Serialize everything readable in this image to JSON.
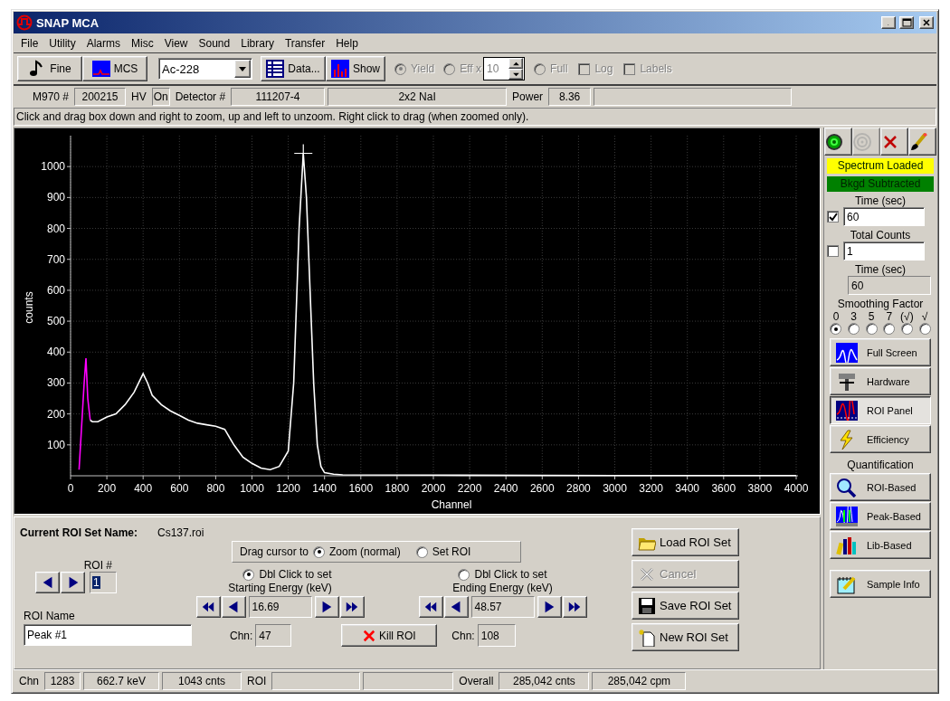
{
  "window": {
    "title": "SNAP MCA"
  },
  "menu": [
    "File",
    "Utility",
    "Alarms",
    "Misc",
    "View",
    "Sound",
    "Library",
    "Transfer",
    "Help"
  ],
  "toolbar": [
    {
      "kind": "button",
      "label": "Fine"
    },
    {
      "kind": "button",
      "label": "MCS"
    },
    {
      "kind": "combo",
      "value": "Ac-228"
    },
    {
      "kind": "button",
      "label": "Data..."
    },
    {
      "kind": "button",
      "label": "Show"
    },
    {
      "kind": "radio",
      "label": "Yield",
      "selected": true,
      "disabled": true
    },
    {
      "kind": "radio",
      "label": "Eff x",
      "selected": false,
      "disabled": true
    },
    {
      "kind": "spin",
      "value": "10",
      "disabled": true
    },
    {
      "kind": "radio",
      "label": "Full",
      "selected": false,
      "disabled": true
    },
    {
      "kind": "checkbox",
      "label": "Log",
      "checked": false,
      "disabled": true
    },
    {
      "kind": "checkbox",
      "label": "Labels",
      "checked": false,
      "disabled": true
    }
  ],
  "info": [
    {
      "kind": "label",
      "text": "M970 #"
    },
    {
      "kind": "field",
      "text": "200215"
    },
    {
      "kind": "label",
      "text": "HV"
    },
    {
      "kind": "field",
      "text": "On"
    },
    {
      "kind": "label",
      "text": "Detector #"
    },
    {
      "kind": "field",
      "text": "111207-4"
    },
    {
      "kind": "field",
      "text": "2x2 NaI"
    },
    {
      "kind": "label",
      "text": "Power"
    },
    {
      "kind": "field",
      "text": "8.36"
    },
    {
      "kind": "field"
    }
  ],
  "hint": "Click and drag box down and right to zoom, up and left to unzoom. Right click to drag (when zoomed only).",
  "chart": {
    "chart_data": {
      "type": "line",
      "xlabel": "Channel",
      "ylabel": "counts",
      "xlim": [
        0,
        4000
      ],
      "ylim": [
        0,
        1100
      ],
      "grid": true,
      "xticks": [
        0,
        200,
        400,
        600,
        800,
        1000,
        1200,
        1400,
        1600,
        1800,
        2000,
        2200,
        2400,
        2600,
        2800,
        3000,
        3200,
        3400,
        3600,
        3800,
        4000
      ],
      "yticks": [
        100,
        200,
        300,
        400,
        500,
        600,
        700,
        800,
        900,
        1000
      ],
      "x": [
        47,
        60,
        75,
        85,
        95,
        108,
        120,
        150,
        200,
        250,
        300,
        350,
        400,
        425,
        450,
        500,
        550,
        600,
        650,
        700,
        750,
        800,
        850,
        900,
        950,
        1000,
        1050,
        1100,
        1150,
        1200,
        1230,
        1260,
        1283,
        1300,
        1320,
        1340,
        1360,
        1380,
        1400,
        1450,
        1500,
        2000,
        3000,
        4000
      ],
      "series": [
        {
          "color": "#ff00ff",
          "values": [
            20,
            150,
            300,
            380,
            250,
            180,
            null,
            null,
            null,
            null,
            null,
            null,
            null,
            null,
            null,
            null,
            null,
            null,
            null,
            null,
            null,
            null,
            null,
            null,
            null,
            null,
            null,
            null,
            null,
            null,
            null,
            null,
            null,
            null,
            null,
            null,
            null,
            null,
            null,
            null,
            null,
            null,
            null,
            null
          ]
        },
        {
          "color": "#ffffff",
          "values": [
            null,
            null,
            null,
            null,
            null,
            180,
            175,
            175,
            190,
            200,
            230,
            270,
            330,
            300,
            260,
            230,
            210,
            195,
            180,
            170,
            165,
            160,
            150,
            100,
            60,
            40,
            25,
            20,
            30,
            80,
            300,
            800,
            1043,
            900,
            600,
            300,
            100,
            30,
            10,
            5,
            3,
            2,
            1,
            1
          ]
        }
      ]
    }
  },
  "side_panel": {
    "tools": [
      {
        "disabled": false
      },
      {
        "disabled": true
      },
      {
        "disabled": false
      },
      {
        "disabled": false
      }
    ],
    "flags": [
      {
        "text": "Spectrum Loaded",
        "color": "#ffff00"
      },
      {
        "text": "Bkgd Subtracted",
        "color": "#008000"
      }
    ],
    "preset_time": {
      "label": "Time (sec)",
      "checked": true,
      "value": "60"
    },
    "preset_counts": {
      "label": "Total Counts",
      "checked": false,
      "value": "1"
    },
    "elapsed": {
      "label": "Time (sec)",
      "value": "60"
    },
    "smoothing": {
      "label": "Smoothing Factor",
      "options": [
        {
          "label": "0",
          "selected": true
        },
        {
          "label": "3",
          "selected": false
        },
        {
          "label": "5",
          "selected": false
        },
        {
          "label": "7",
          "selected": false
        },
        {
          "label": "(√)",
          "selected": false
        },
        {
          "label": "√",
          "selected": false
        }
      ]
    },
    "views": [
      {
        "label": "Full Screen",
        "selected": false
      },
      {
        "label": "Hardware",
        "selected": false
      },
      {
        "label": "ROI Panel",
        "selected": true
      },
      {
        "label": "Efficiency",
        "selected": false
      }
    ],
    "quant_label": "Quantification",
    "quant": [
      {
        "label": "ROI-Based"
      },
      {
        "label": "Peak-Based"
      },
      {
        "label": "Lib-Based"
      }
    ],
    "info_button": {
      "label": "Sample Info"
    }
  },
  "roi_panel": {
    "set_label": "Current ROI Set Name:",
    "set_name": "Cs137.roi",
    "drag": {
      "label": "Drag cursor to",
      "options": [
        {
          "label": "Zoom (normal)",
          "selected": true
        },
        {
          "label": "Set ROI",
          "selected": false
        }
      ]
    },
    "roi_number": {
      "label": "ROI #",
      "value": "1"
    },
    "roi_name": {
      "label": "ROI Name",
      "value": "Peak #1"
    },
    "start": {
      "radio_label": "Dbl Click to set",
      "selected": true,
      "title": "Starting Energy (keV)",
      "energy": "16.69",
      "chn_label": "Chn:",
      "chn": "47"
    },
    "end": {
      "radio_label": "Dbl Click to set",
      "selected": false,
      "title": "Ending Energy (keV)",
      "energy": "48.57",
      "chn_label": "Chn:",
      "chn": "108"
    },
    "kill": {
      "label": "Kill ROI"
    },
    "buttons": [
      {
        "label": "Load ROI Set",
        "disabled": false
      },
      {
        "label": "Cancel",
        "disabled": true
      },
      {
        "label": "Save ROI Set",
        "disabled": false
      },
      {
        "label": "New ROI Set",
        "disabled": false
      }
    ]
  },
  "status": [
    {
      "kind": "label",
      "text": "Chn"
    },
    {
      "kind": "field",
      "text": "1283"
    },
    {
      "kind": "field",
      "text": "662.7 keV"
    },
    {
      "kind": "field",
      "text": "1043 cnts"
    },
    {
      "kind": "label",
      "text": "ROI"
    },
    {
      "kind": "field"
    },
    {
      "kind": "field"
    },
    {
      "kind": "label",
      "text": "Overall"
    },
    {
      "kind": "field",
      "text": "285,042 cnts"
    },
    {
      "kind": "field",
      "text": "285,042 cpm"
    }
  ]
}
